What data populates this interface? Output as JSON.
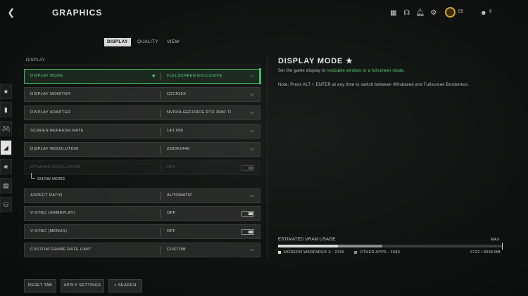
{
  "header": {
    "back_icon": "chevron-left-icon",
    "title": "GRAPHICS",
    "icons": [
      "grid-icon",
      "headset-icon",
      "bell-icon",
      "gear-icon"
    ],
    "cod_points": "55",
    "friends": "9"
  },
  "tabs": [
    {
      "label": "DISPLAY",
      "active": true
    },
    {
      "label": "QUALITY",
      "active": false
    },
    {
      "label": "VIEW",
      "active": false
    }
  ],
  "rail": [
    "star-icon",
    "controller-icon",
    "gamepad-icon",
    "graphics-icon",
    "speaker-icon",
    "interface-icon",
    "account-icon"
  ],
  "section_title": "DISPLAY",
  "rows": [
    {
      "label": "DISPLAY MODE",
      "value": "FULLSCREEN EXCLUSIVE",
      "control": "dropdown",
      "active": true,
      "favorite": true
    },
    {
      "label": "DISPLAY MONITOR",
      "value": "C27JG5X",
      "control": "dropdown"
    },
    {
      "label": "DISPLAY ADAPTER",
      "value": "NVIDIA GEFORCE RTX 3060 TI",
      "control": "dropdown"
    },
    {
      "label": "SCREEN REFRESH RATE",
      "value": "143.998",
      "control": "dropdown"
    },
    {
      "label": "DISPLAY RESOLUTION",
      "value": "2560X1440",
      "control": "dropdown"
    },
    {
      "label": "DYNAMIC RESOLUTION",
      "value": "OFF",
      "control": "toggle",
      "disabled": true
    },
    {
      "label": "ASPECT RATIO",
      "value": "AUTOMATIC",
      "control": "dropdown"
    },
    {
      "label": "V-SYNC (GAMEPLAY)",
      "value": "OFF",
      "control": "toggle"
    },
    {
      "label": "V-SYNC (MENUS)",
      "value": "OFF",
      "control": "toggle"
    },
    {
      "label": "CUSTOM FRAME RATE LIMIT",
      "value": "CUSTOM",
      "control": "dropdown"
    }
  ],
  "show_more": "SHOW MORE",
  "buttons": {
    "reset": "RESET TAB",
    "apply": "APPLY SETTINGS",
    "search": "SEARCH"
  },
  "panel": {
    "title": "DISPLAY MODE",
    "title_star": "★",
    "desc_prefix": "Set the game display to ",
    "desc_highlight": "resizable window or a fullscreen mode.",
    "note": "Note: Press ALT + ENTER at any time to switch between Windowed and Fullscreen Borderless."
  },
  "vram": {
    "title": "ESTIMATED VRAM USAGE",
    "max_label": "MAX",
    "mw_label": "MODERN WARFARE® II : 2139",
    "other_label": "OTHER APPS : 1583",
    "total": "3722 / 8038 MB",
    "mw_mb": 2139,
    "other_mb": 1583,
    "max_mb": 8038
  },
  "colors": {
    "accent": "#55d56e",
    "coin": "#d6a62a"
  }
}
